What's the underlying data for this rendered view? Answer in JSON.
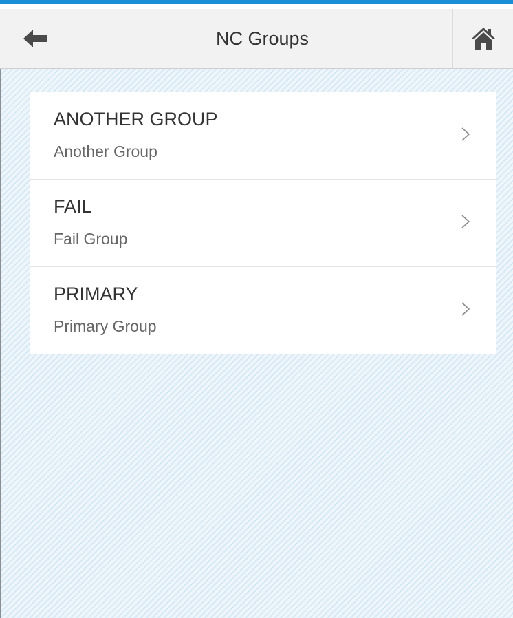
{
  "theme": {
    "accent_color": "#1a8ed6"
  },
  "header": {
    "title": "NC Groups",
    "back_icon": "arrow-left-icon",
    "home_icon": "home-icon"
  },
  "groups": [
    {
      "name": "ANOTHER GROUP",
      "description": "Another Group"
    },
    {
      "name": "FAIL",
      "description": "Fail Group"
    },
    {
      "name": "PRIMARY",
      "description": "Primary Group"
    }
  ]
}
